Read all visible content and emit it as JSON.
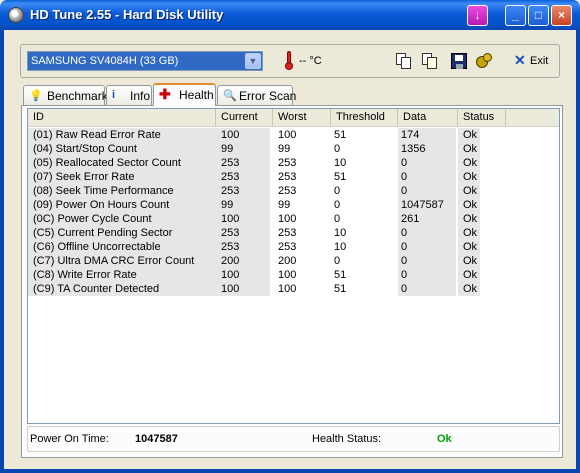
{
  "window": {
    "title": "HD Tune 2.55 - Hard Disk Utility",
    "buttons": {
      "minimize": "_",
      "maximize": "□",
      "close": "×",
      "menu": "↓"
    }
  },
  "toolbar": {
    "drive": "SAMSUNG SV4084H (33 GB)",
    "temperature": "-- °C",
    "exit_label": "Exit",
    "icons": [
      "copy-icon",
      "copy-all-icon",
      "save-icon",
      "options-icon",
      "exit-icon"
    ]
  },
  "tabs": [
    {
      "label": "Benchmark",
      "icon": "benchmark-icon"
    },
    {
      "label": "Info",
      "icon": "info-icon"
    },
    {
      "label": "Health",
      "icon": "health-icon",
      "selected": true
    },
    {
      "label": "Error Scan",
      "icon": "magnifier-icon"
    }
  ],
  "health": {
    "columns": [
      "ID",
      "Current",
      "Worst",
      "Threshold",
      "Data",
      "Status"
    ],
    "rows": [
      {
        "id": "(01) Raw Read Error Rate",
        "current": "100",
        "worst": "100",
        "threshold": "51",
        "data": "174",
        "status": "Ok"
      },
      {
        "id": "(04) Start/Stop Count",
        "current": "99",
        "worst": "99",
        "threshold": "0",
        "data": "1356",
        "status": "Ok"
      },
      {
        "id": "(05) Reallocated Sector Count",
        "current": "253",
        "worst": "253",
        "threshold": "10",
        "data": "0",
        "status": "Ok"
      },
      {
        "id": "(07) Seek Error Rate",
        "current": "253",
        "worst": "253",
        "threshold": "51",
        "data": "0",
        "status": "Ok"
      },
      {
        "id": "(08) Seek Time Performance",
        "current": "253",
        "worst": "253",
        "threshold": "0",
        "data": "0",
        "status": "Ok"
      },
      {
        "id": "(09) Power On Hours Count",
        "current": "99",
        "worst": "99",
        "threshold": "0",
        "data": "1047587",
        "status": "Ok"
      },
      {
        "id": "(0C) Power Cycle Count",
        "current": "100",
        "worst": "100",
        "threshold": "0",
        "data": "261",
        "status": "Ok"
      },
      {
        "id": "(C5) Current Pending Sector",
        "current": "253",
        "worst": "253",
        "threshold": "10",
        "data": "0",
        "status": "Ok"
      },
      {
        "id": "(C6) Offline Uncorrectable",
        "current": "253",
        "worst": "253",
        "threshold": "10",
        "data": "0",
        "status": "Ok"
      },
      {
        "id": "(C7) Ultra DMA CRC Error Count",
        "current": "200",
        "worst": "200",
        "threshold": "0",
        "data": "0",
        "status": "Ok"
      },
      {
        "id": "(C8) Write Error Rate",
        "current": "100",
        "worst": "100",
        "threshold": "51",
        "data": "0",
        "status": "Ok"
      },
      {
        "id": "(C9) TA Counter Detected",
        "current": "100",
        "worst": "100",
        "threshold": "51",
        "data": "0",
        "status": "Ok"
      }
    ]
  },
  "status_bar": {
    "power_on_label": "Power On Time:",
    "power_on_value": "1047587",
    "health_label": "Health Status:",
    "health_value": "Ok",
    "health_color": "#00a000"
  }
}
